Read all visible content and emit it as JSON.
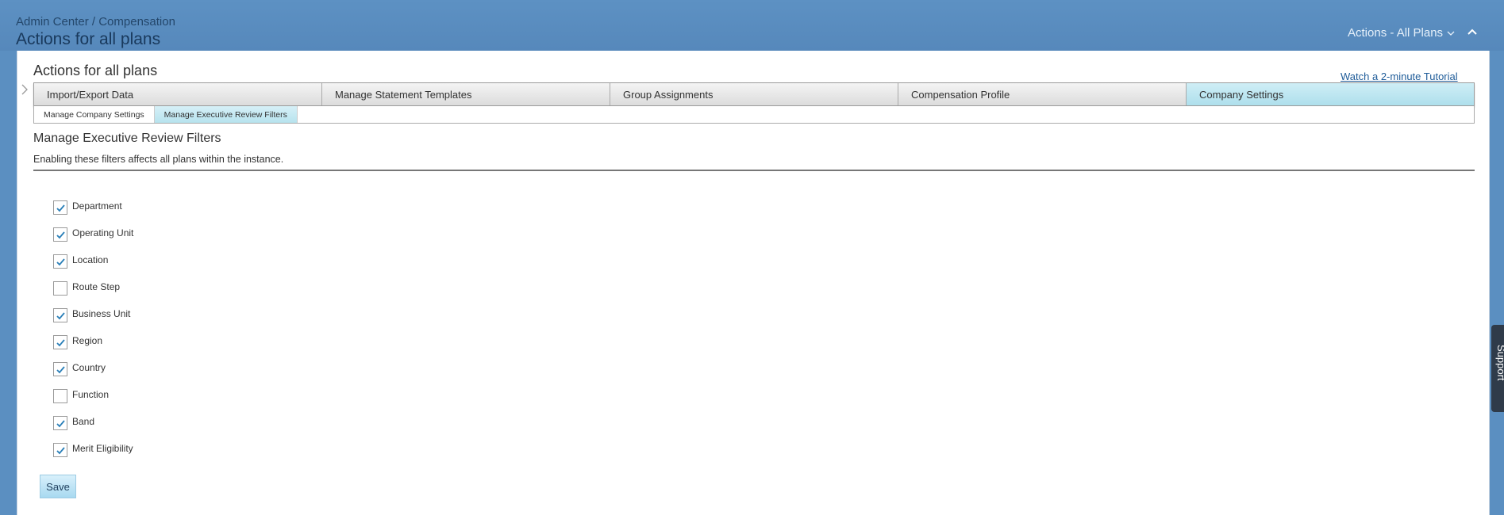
{
  "header": {
    "breadcrumb": "Admin Center / Compensation",
    "title": "Actions for all plans",
    "actions_menu_label": "Actions - All Plans"
  },
  "panel": {
    "title": "Actions for all plans",
    "tutorial_link": "Watch a 2-minute Tutorial"
  },
  "tabs": [
    {
      "label": "Import/Export Data",
      "active": false
    },
    {
      "label": "Manage Statement Templates",
      "active": false
    },
    {
      "label": "Group Assignments",
      "active": false
    },
    {
      "label": "Compensation Profile",
      "active": false
    },
    {
      "label": "Company Settings",
      "active": true
    }
  ],
  "subtabs": [
    {
      "label": "Manage Company Settings",
      "active": false
    },
    {
      "label": "Manage Executive Review Filters",
      "active": true
    }
  ],
  "section": {
    "title": "Manage Executive Review Filters",
    "description": "Enabling these filters affects all plans within the instance."
  },
  "filters": [
    {
      "label": "Department",
      "checked": true
    },
    {
      "label": "Operating Unit",
      "checked": true
    },
    {
      "label": "Location",
      "checked": true
    },
    {
      "label": "Route Step",
      "checked": false
    },
    {
      "label": "Business Unit",
      "checked": true
    },
    {
      "label": "Region",
      "checked": true
    },
    {
      "label": "Country",
      "checked": true
    },
    {
      "label": "Function",
      "checked": false
    },
    {
      "label": "Band",
      "checked": true
    },
    {
      "label": "Merit Eligibility",
      "checked": true
    }
  ],
  "save_label": "Save",
  "support_label": "Support",
  "colors": {
    "header_bg": "#5b8fc1",
    "active_tab": "#aedfec",
    "check_color": "#2a7fb8",
    "link": "#1f5c99"
  },
  "icons": {
    "actions_menu": "chevron-down-icon",
    "collapse": "chevron-up-icon",
    "side_arrow": "chevron-right-icon",
    "checkbox": "checkmark-icon"
  }
}
